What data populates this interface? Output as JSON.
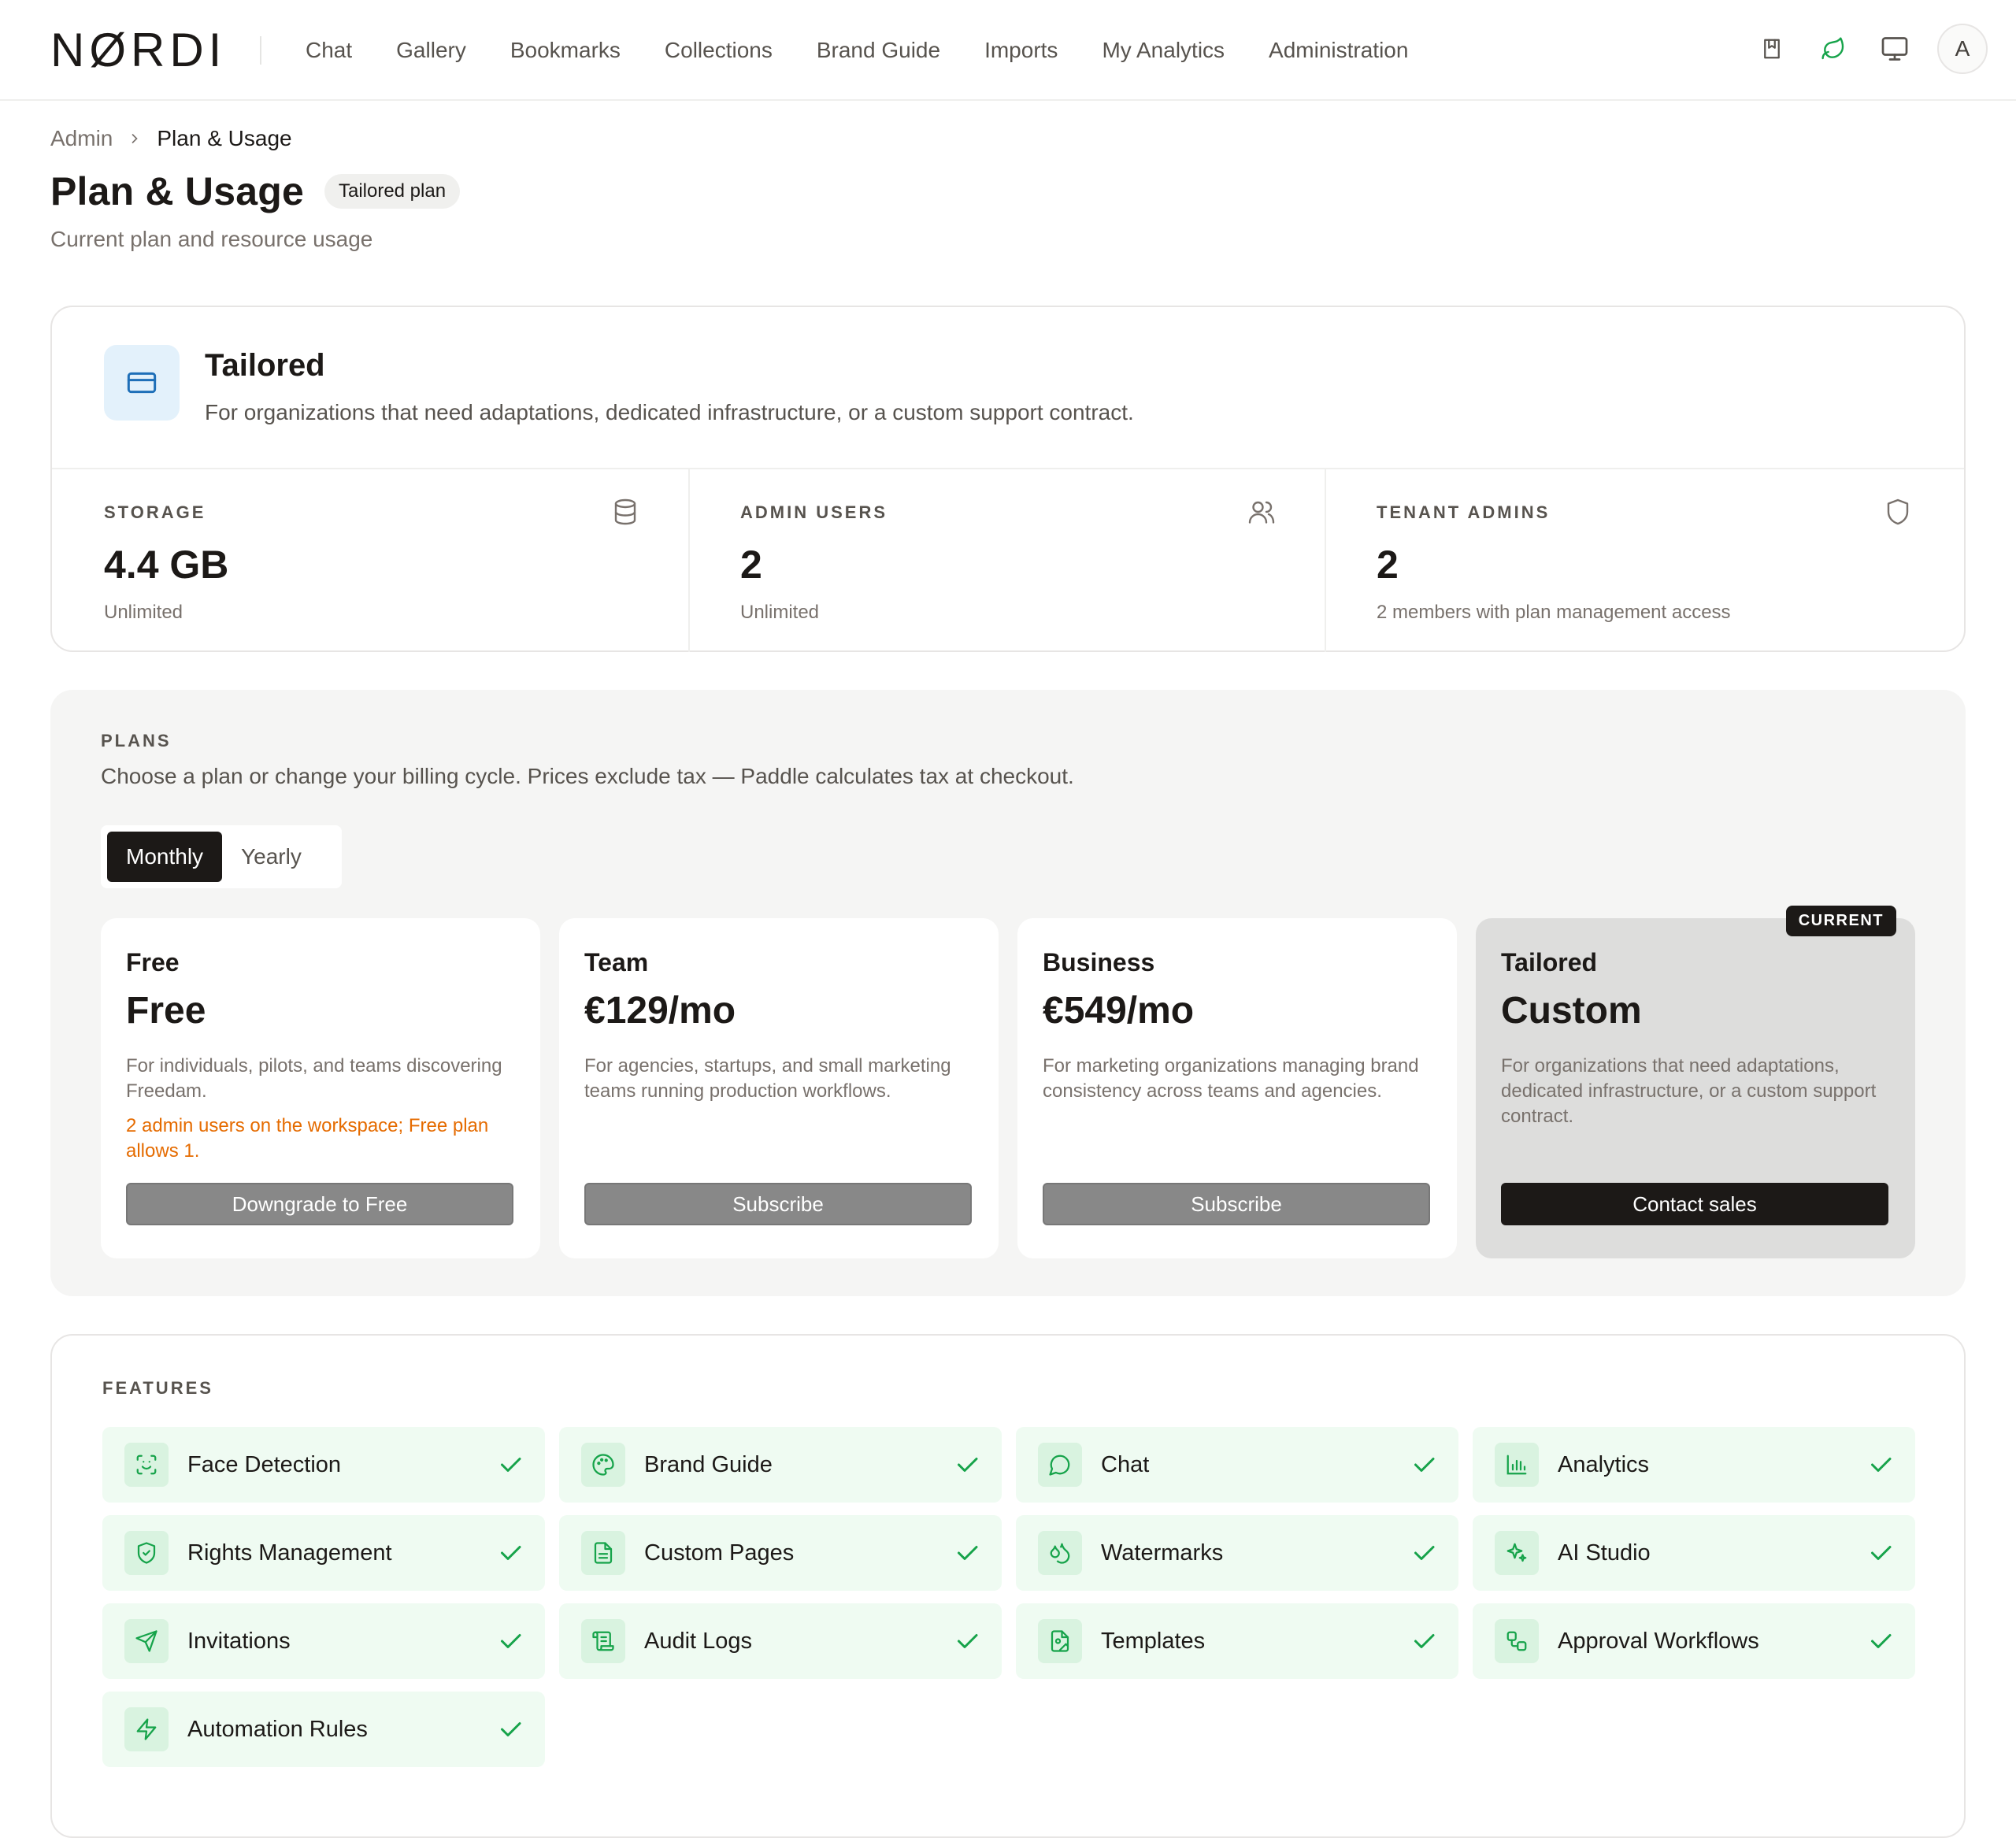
{
  "nav": {
    "logo": "NØRDI",
    "links": [
      "Chat",
      "Gallery",
      "Bookmarks",
      "Collections",
      "Brand Guide",
      "Imports",
      "My Analytics",
      "Administration"
    ],
    "avatar_initial": "A",
    "icons": [
      "bookmark-book-icon",
      "leaf-icon",
      "monitor-icon"
    ],
    "accent_color": "#16a34a"
  },
  "breadcrumb": {
    "root": "Admin",
    "current": "Plan & Usage"
  },
  "header": {
    "title": "Plan & Usage",
    "badge": "Tailored plan",
    "subtitle": "Current plan and resource usage"
  },
  "current_plan": {
    "name": "Tailored",
    "description": "For organizations that need adaptations, dedicated infrastructure, or a custom support contract.",
    "icon": "credit-card-icon",
    "stats": [
      {
        "label": "STORAGE",
        "value": "4.4 GB",
        "note": "Unlimited",
        "icon": "database-icon"
      },
      {
        "label": "ADMIN USERS",
        "value": "2",
        "note": "Unlimited",
        "icon": "users-icon"
      },
      {
        "label": "TENANT ADMINS",
        "value": "2",
        "note": "2 members with plan management access",
        "icon": "shield-icon"
      }
    ]
  },
  "plans": {
    "label": "PLANS",
    "description": "Choose a plan or change your billing cycle. Prices exclude tax — Paddle calculates tax at checkout.",
    "cycles": [
      "Monthly",
      "Yearly"
    ],
    "selected_cycle": "Monthly",
    "items": [
      {
        "name": "Free",
        "price": "Free",
        "description": "For individuals, pilots, and teams discovering Freedam.",
        "warning": "2 admin users on the workspace; Free plan allows 1.",
        "button": "Downgrade to Free"
      },
      {
        "name": "Team",
        "price": "€129/mo",
        "description": "For agencies, startups, and small marketing teams running production workflows.",
        "button": "Subscribe"
      },
      {
        "name": "Business",
        "price": "€549/mo",
        "description": "For marketing organizations managing brand consistency across teams and agencies.",
        "button": "Subscribe"
      },
      {
        "name": "Tailored",
        "price": "Custom",
        "description": "For organizations that need adaptations, dedicated infrastructure, or a custom support contract.",
        "button": "Contact sales",
        "badge": "CURRENT"
      }
    ]
  },
  "features": {
    "label": "FEATURES",
    "items": [
      {
        "label": "Face Detection",
        "icon": "face-scan-icon"
      },
      {
        "label": "Brand Guide",
        "icon": "palette-icon"
      },
      {
        "label": "Chat",
        "icon": "chat-bubble-icon"
      },
      {
        "label": "Analytics",
        "icon": "bar-chart-icon"
      },
      {
        "label": "Rights Management",
        "icon": "shield-check-icon"
      },
      {
        "label": "Custom Pages",
        "icon": "file-text-icon"
      },
      {
        "label": "Watermarks",
        "icon": "droplets-icon"
      },
      {
        "label": "AI Studio",
        "icon": "sparkles-icon"
      },
      {
        "label": "Invitations",
        "icon": "send-icon"
      },
      {
        "label": "Audit Logs",
        "icon": "scroll-icon"
      },
      {
        "label": "Templates",
        "icon": "file-image-icon"
      },
      {
        "label": "Approval Workflows",
        "icon": "workflow-icon"
      },
      {
        "label": "Automation Rules",
        "icon": "zap-icon"
      }
    ],
    "check_color": "#16a34a"
  }
}
